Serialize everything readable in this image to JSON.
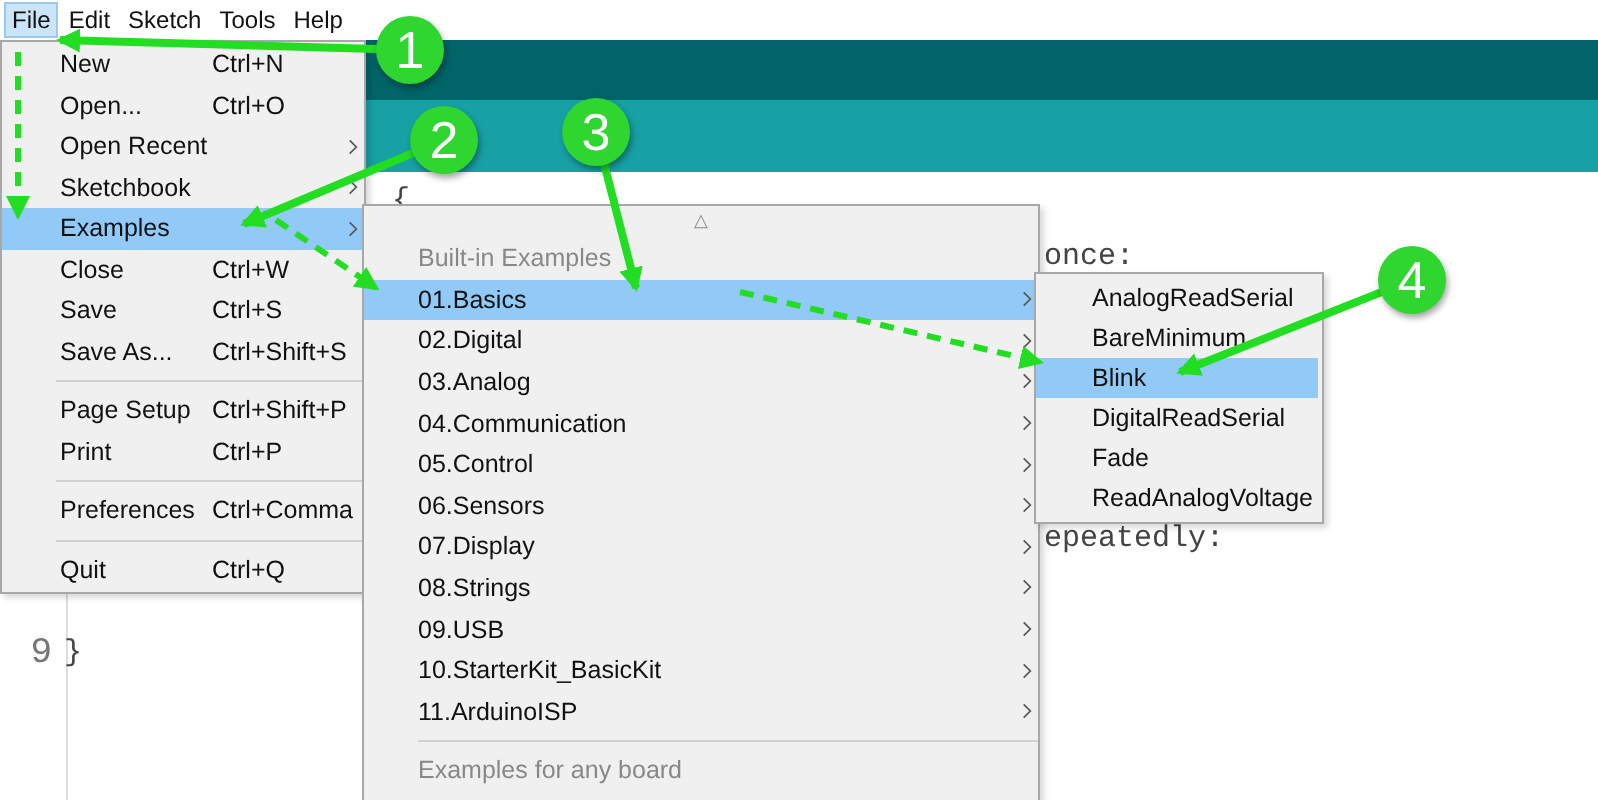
{
  "menubar": [
    {
      "label": "File",
      "selected": true
    },
    {
      "label": "Edit",
      "selected": false
    },
    {
      "label": "Sketch",
      "selected": false
    },
    {
      "label": "Tools",
      "selected": false
    },
    {
      "label": "Help",
      "selected": false
    }
  ],
  "editor": {
    "lines": [
      {
        "text": "{"
      },
      {
        "text": "once:"
      },
      {
        "text": "epeatedly:"
      },
      {
        "number": "9",
        "text": "}"
      }
    ]
  },
  "file_menu": [
    {
      "kind": "item",
      "label": "New",
      "shortcut": "Ctrl+N",
      "submenu": false,
      "selected": false
    },
    {
      "kind": "item",
      "label": "Open...",
      "shortcut": "Ctrl+O",
      "submenu": false,
      "selected": false
    },
    {
      "kind": "item",
      "label": "Open Recent",
      "submenu": true,
      "selected": false
    },
    {
      "kind": "item",
      "label": "Sketchbook",
      "submenu": true,
      "selected": false
    },
    {
      "kind": "item",
      "label": "Examples",
      "submenu": true,
      "selected": true
    },
    {
      "kind": "item",
      "label": "Close",
      "shortcut": "Ctrl+W",
      "submenu": false,
      "selected": false
    },
    {
      "kind": "item",
      "label": "Save",
      "shortcut": "Ctrl+S",
      "submenu": false,
      "selected": false
    },
    {
      "kind": "item",
      "label": "Save As...",
      "shortcut": "Ctrl+Shift+S",
      "submenu": false,
      "selected": false
    },
    {
      "kind": "separator"
    },
    {
      "kind": "item",
      "label": "Page Setup",
      "shortcut": "Ctrl+Shift+P",
      "submenu": false,
      "selected": false
    },
    {
      "kind": "item",
      "label": "Print",
      "shortcut": "Ctrl+P",
      "submenu": false,
      "selected": false
    },
    {
      "kind": "separator"
    },
    {
      "kind": "item",
      "label": "Preferences",
      "shortcut": "Ctrl+Comma",
      "submenu": false,
      "selected": false
    },
    {
      "kind": "separator"
    },
    {
      "kind": "item",
      "label": "Quit",
      "shortcut": "Ctrl+Q",
      "submenu": false,
      "selected": false
    }
  ],
  "examples_menu": [
    {
      "kind": "scroll",
      "label": "△"
    },
    {
      "kind": "header",
      "label": "Built-in Examples"
    },
    {
      "kind": "item",
      "label": "01.Basics",
      "submenu": true,
      "selected": true
    },
    {
      "kind": "item",
      "label": "02.Digital",
      "submenu": true,
      "selected": false
    },
    {
      "kind": "item",
      "label": "03.Analog",
      "submenu": true,
      "selected": false
    },
    {
      "kind": "item",
      "label": "04.Communication",
      "submenu": true,
      "selected": false
    },
    {
      "kind": "item",
      "label": "05.Control",
      "submenu": true,
      "selected": false
    },
    {
      "kind": "item",
      "label": "06.Sensors",
      "submenu": true,
      "selected": false
    },
    {
      "kind": "item",
      "label": "07.Display",
      "submenu": true,
      "selected": false
    },
    {
      "kind": "item",
      "label": "08.Strings",
      "submenu": true,
      "selected": false
    },
    {
      "kind": "item",
      "label": "09.USB",
      "submenu": true,
      "selected": false
    },
    {
      "kind": "item",
      "label": "10.StarterKit_BasicKit",
      "submenu": true,
      "selected": false
    },
    {
      "kind": "item",
      "label": "11.ArduinoISP",
      "submenu": true,
      "selected": false
    },
    {
      "kind": "separator"
    },
    {
      "kind": "header",
      "label": "Examples for any board"
    }
  ],
  "basics_menu": [
    {
      "label": "AnalogReadSerial",
      "selected": false
    },
    {
      "label": "BareMinimum",
      "selected": false
    },
    {
      "label": "Blink",
      "selected": true
    },
    {
      "label": "DigitalReadSerial",
      "selected": false
    },
    {
      "label": "Fade",
      "selected": false
    },
    {
      "label": "ReadAnalogVoltage",
      "selected": false
    }
  ],
  "steps": [
    {
      "number": "1"
    },
    {
      "number": "2"
    },
    {
      "number": "3"
    },
    {
      "number": "4"
    }
  ]
}
